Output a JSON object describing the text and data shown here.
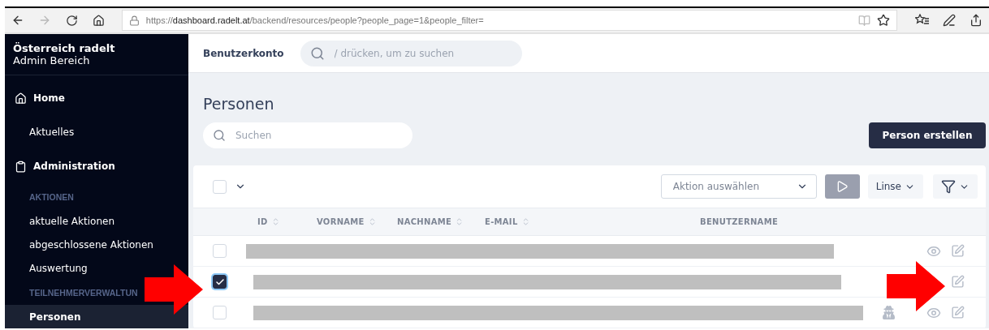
{
  "browser": {
    "url": {
      "scheme": "https://",
      "domain": "dashboard.radelt.at",
      "path": "/backend/resources/people?people_page=1&people_filter="
    },
    "forward_disabled": true
  },
  "sidebar": {
    "title": "Österreich radelt",
    "subtitle": "Admin Bereich",
    "items": [
      {
        "kind": "group",
        "label": "Home",
        "selected": false
      },
      {
        "kind": "link",
        "label": "Aktuelles",
        "selected": false
      },
      {
        "kind": "group",
        "label": "Administration",
        "selected": false
      },
      {
        "kind": "section",
        "label": "AKTIONEN",
        "selected": false
      },
      {
        "kind": "link",
        "label": "aktuelle Aktionen",
        "selected": false
      },
      {
        "kind": "link",
        "label": "abgeschlossene Aktionen",
        "selected": false
      },
      {
        "kind": "link",
        "label": "Auswertung",
        "selected": false
      },
      {
        "kind": "section",
        "label": "TEILNEHMERVERWALTUN",
        "selected": false
      },
      {
        "kind": "link",
        "label": "Personen",
        "selected": true
      }
    ]
  },
  "header": {
    "account": "Benutzerkonto",
    "search": {
      "placeholder": "/ drücken, um zu suchen"
    }
  },
  "page": {
    "title": "Personen",
    "search": {
      "placeholder": "Suchen"
    },
    "create_button": "Person erstellen"
  },
  "table": {
    "select_all": {
      "checked": false
    },
    "action_select": {
      "placeholder": "Aktion auswählen"
    },
    "run_disabled": true,
    "lens_button": "Linse",
    "columns": [
      {
        "label": "ID",
        "sortable": true
      },
      {
        "label": "VORNAME",
        "sortable": true
      },
      {
        "label": "NACHNAME",
        "sortable": true
      },
      {
        "label": "E-MAIL",
        "sortable": true
      },
      {
        "label": "BENUTZERNAME",
        "sortable": false
      }
    ],
    "rows": [
      {
        "selected": false,
        "redacted": true,
        "impersonate": false,
        "view_shown": true
      },
      {
        "selected": true,
        "redacted": true,
        "impersonate": false,
        "view_shown": false
      },
      {
        "selected": false,
        "redacted": true,
        "impersonate": true,
        "view_shown": true
      }
    ]
  },
  "annotations": [
    {
      "kind": "arrow"
    },
    {
      "kind": "arrow"
    }
  ]
}
